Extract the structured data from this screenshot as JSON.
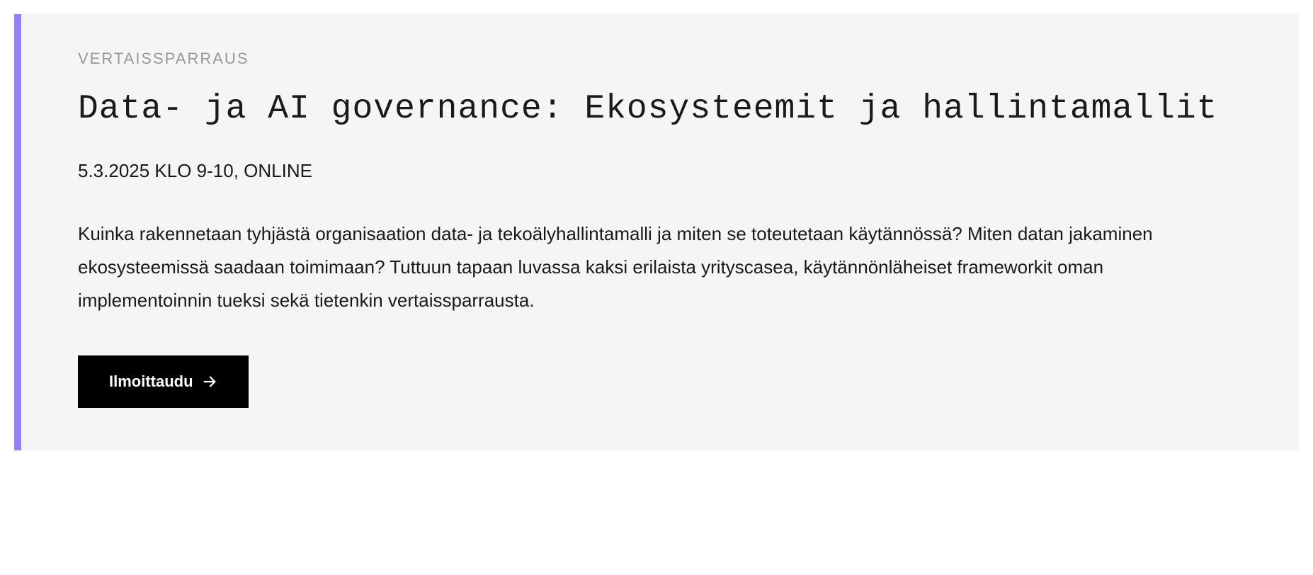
{
  "card": {
    "category": "VERTAISSPARRAUS",
    "title": "Data- ja AI governance: Ekosysteemit ja hallintamallit",
    "datetime": "5.3.2025 KLO 9-10, ONLINE",
    "description": "Kuinka rakennetaan tyhjästä organisaation data- ja tekoälyhallintamalli ja miten se toteutetaan käytännössä? Miten datan jakaminen ekosysteemissä saadaan toimimaan? Tuttuun tapaan luvassa kaksi erilaista yrityscasea, käytännönläheiset frameworkit oman implementoinnin tueksi sekä tietenkin vertaissparrausta.",
    "cta_label": "Ilmoittaudu"
  },
  "colors": {
    "accent": "#9381ff",
    "background": "#f5f5f5",
    "button": "#000000"
  }
}
